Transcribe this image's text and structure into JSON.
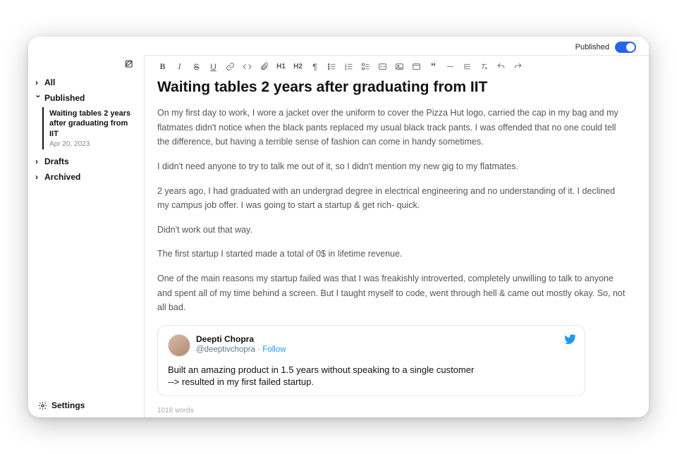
{
  "header": {
    "publishedLabel": "Published"
  },
  "sidebar": {
    "all": "All",
    "published": "Published",
    "drafts": "Drafts",
    "archived": "Archived",
    "settings": "Settings",
    "activePost": {
      "title": "Waiting tables 2 years after graduating from IIT",
      "date": "Apr 20, 2023"
    }
  },
  "doc": {
    "title": "Waiting tables 2 years after graduating from IIT",
    "p1": "On my first day to work, I wore a jacket over the uniform to cover the Pizza Hut logo, carried the cap in my bag and my flatmates didn't notice when the black pants replaced my usual black track pants. I was offended that no one could tell the difference, but having a terrible sense of fashion can come in handy sometimes.",
    "p2": "I didn't need anyone to try to talk me out of it, so I didn't mention my new gig to my flatmates.",
    "p3": "2 years ago, I had graduated with an undergrad degree in electrical engineering and no understanding of it. I declined my campus job offer. I was going to start a startup & get rich- quick.",
    "p4": "Didn't work out that way.",
    "p5": "The first startup I started made a total of 0$ in lifetime revenue.",
    "p6": "One of the main reasons my startup failed was that I was freakishly introverted, completely unwilling to talk to anyone and spent all of my time behind a screen. But I taught myself to code, went through hell & came out mostly okay. So, not all bad.",
    "wordcount": "1018 words"
  },
  "tweet": {
    "name": "Deepti Chopra",
    "handle": "@deeptivchopra",
    "follow": "Follow",
    "line1": "Built an amazing product in 1.5 years without speaking to a single customer",
    "line2": "--> resulted in my first failed startup."
  }
}
